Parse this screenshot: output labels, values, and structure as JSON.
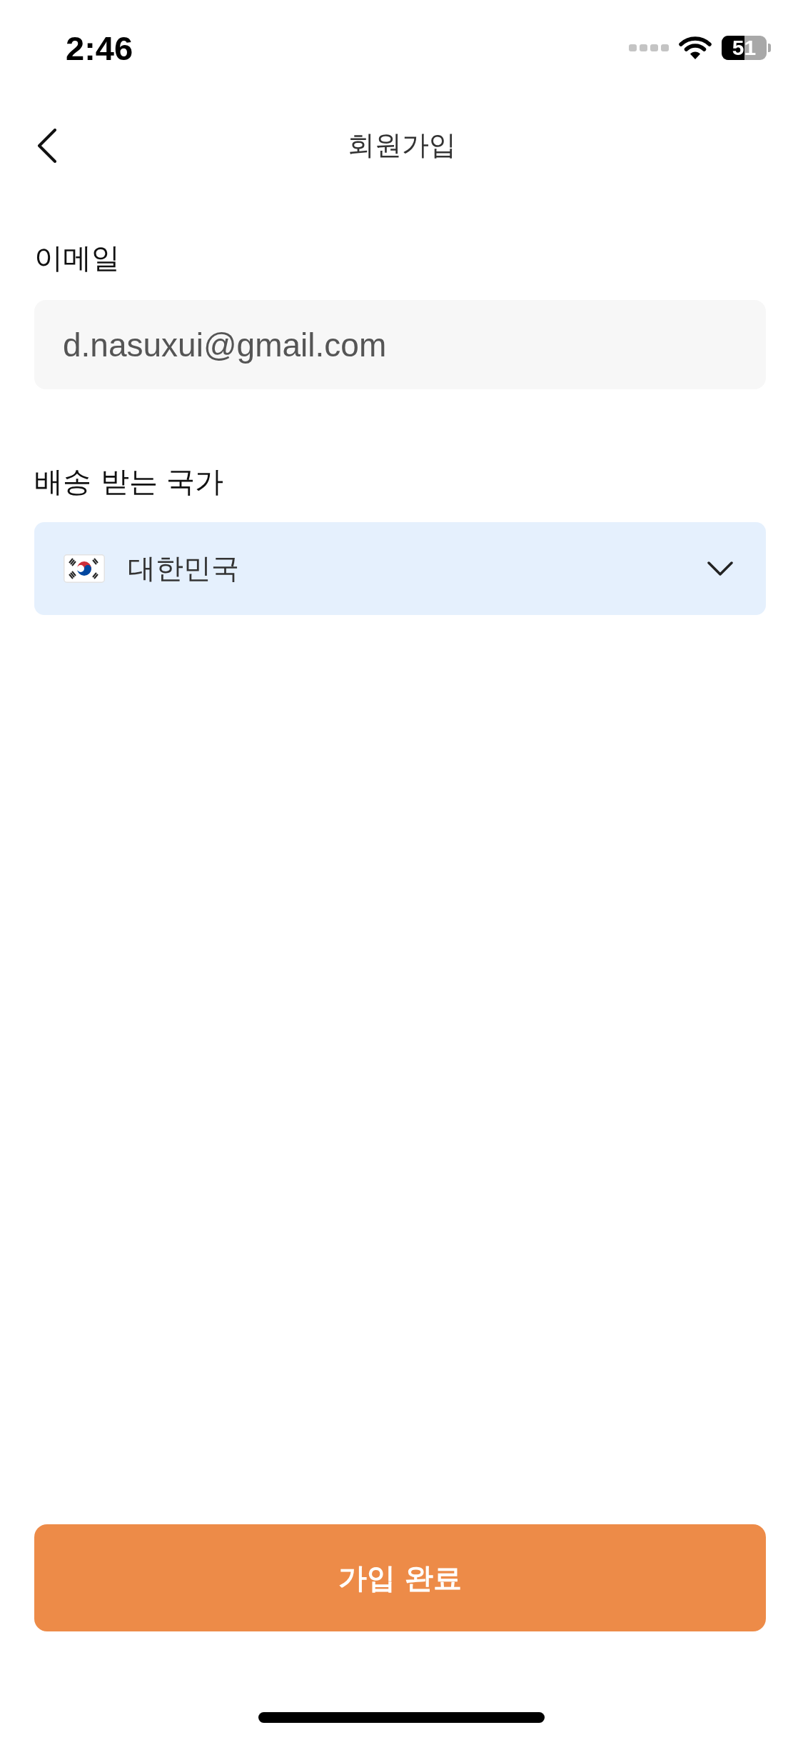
{
  "status_bar": {
    "time": "2:46",
    "battery": "51"
  },
  "header": {
    "title": "회원가입"
  },
  "form": {
    "fields": [
      {
        "kind": "text",
        "label": "이메일",
        "value": "d.nasuxui@gmail.com"
      },
      {
        "kind": "select",
        "label": "배송 받는 국가",
        "value": "대한민국"
      }
    ]
  },
  "submit_button": {
    "label": "가입 완료"
  }
}
